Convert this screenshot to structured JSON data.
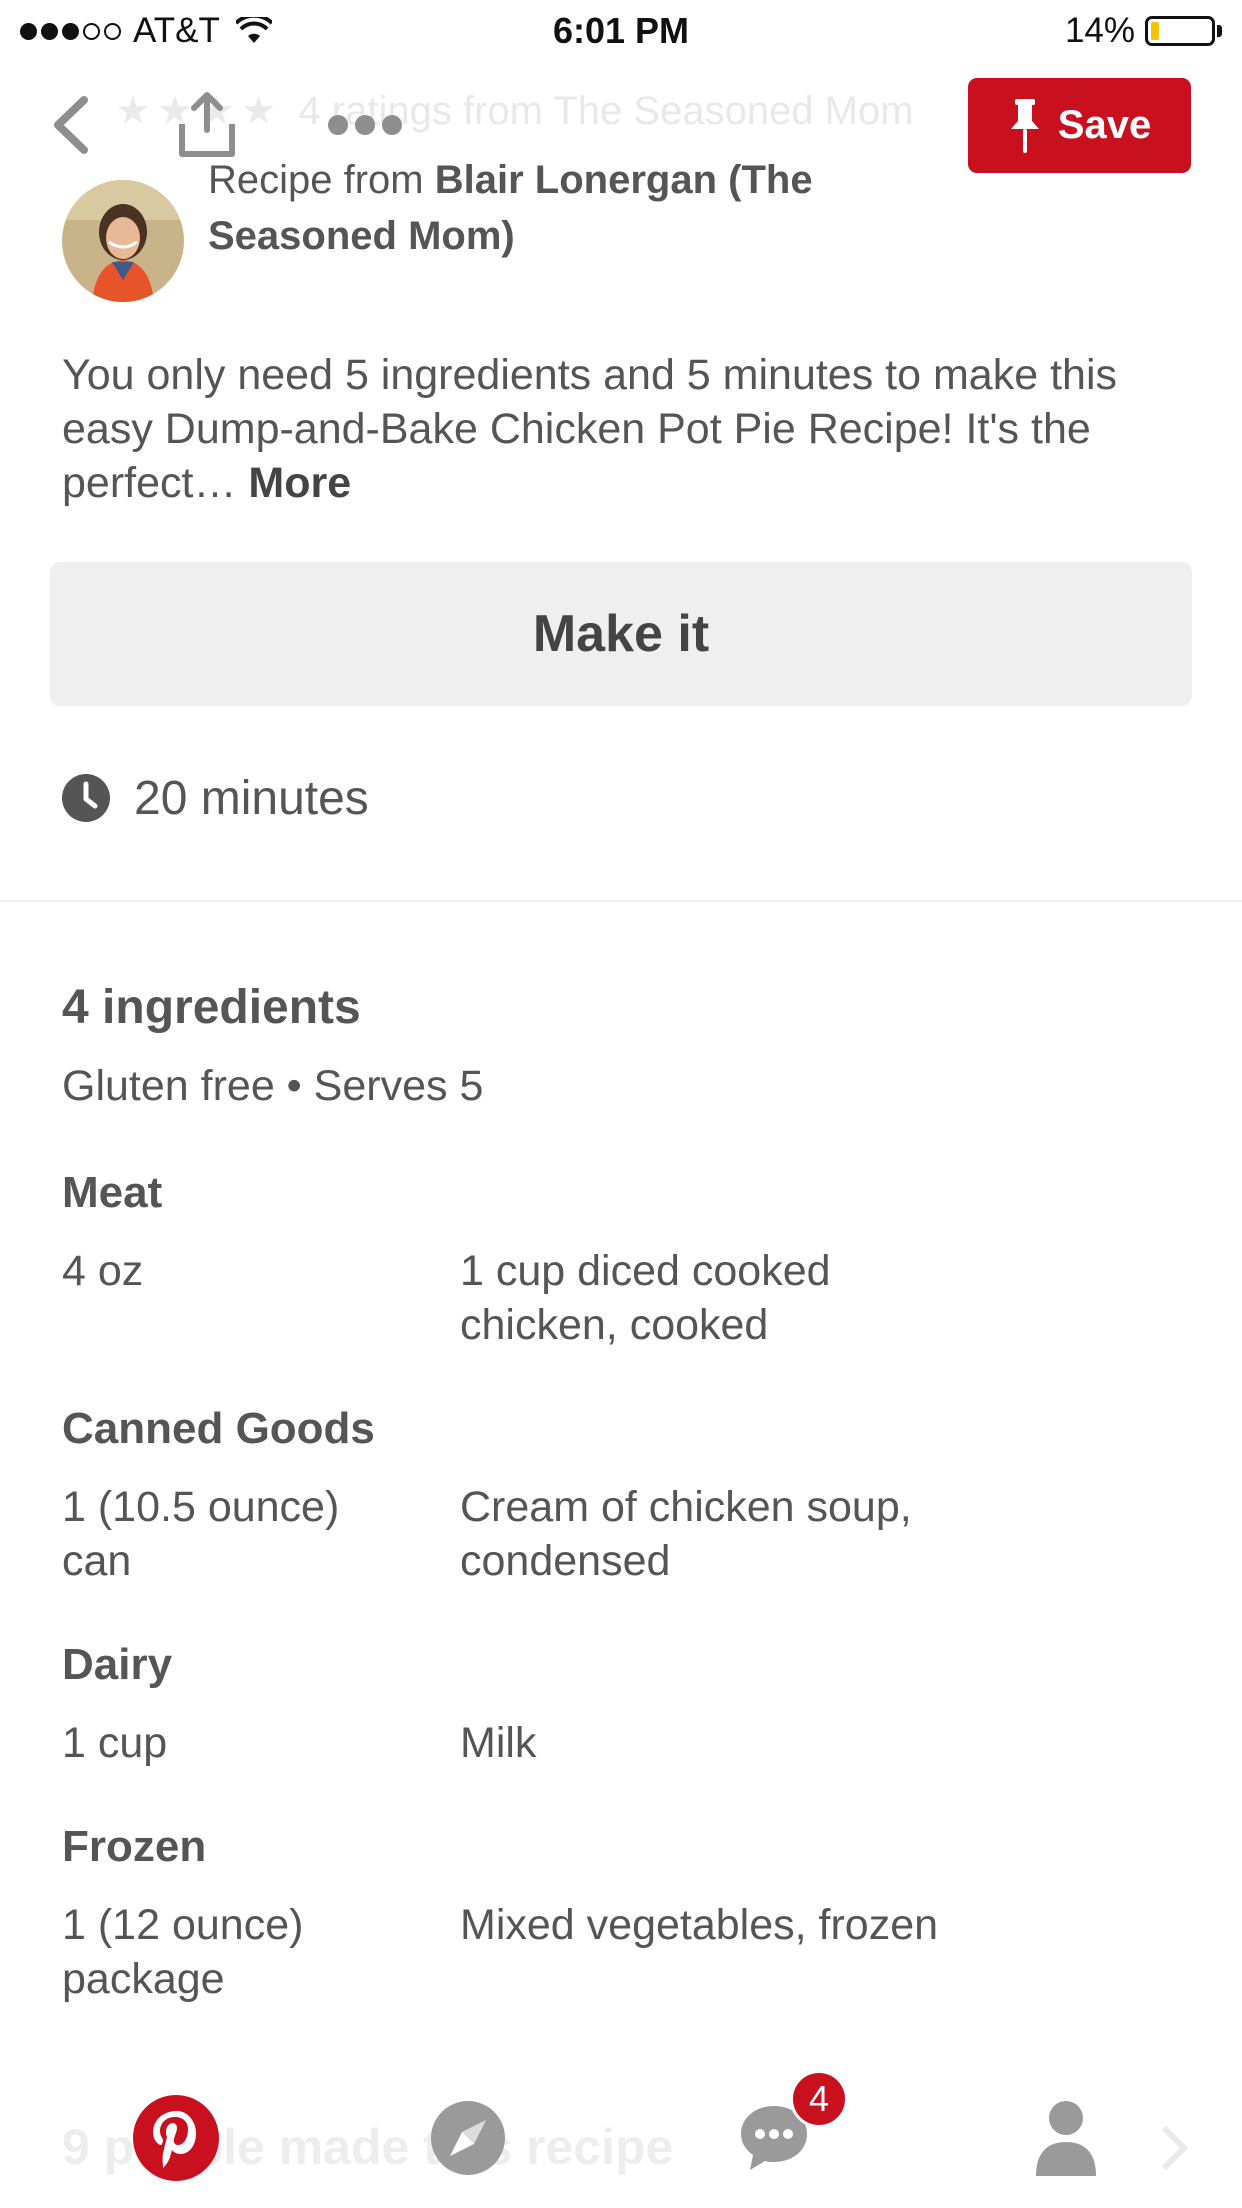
{
  "status_bar": {
    "carrier": "AT&T",
    "time": "6:01 PM",
    "battery": "14%",
    "battery_level": 0.14,
    "signal_bars": 3
  },
  "top_bar": {
    "ratings": "4 ratings from The Seasoned Mom",
    "save_label": "Save",
    "icons": [
      "back-icon",
      "share-icon",
      "more-icon",
      "pin-icon"
    ]
  },
  "recipe": {
    "source_prefix": "Recipe from",
    "source_name_line1": "Blair Lonergan (The",
    "source_name_line2": "Seasoned Mom)",
    "description": "You only need 5 ingredients and 5 minutes to make this easy Dump-and-Bake Chicken Pot Pie Recipe! It's the perfect…",
    "more_label": "More",
    "make_it_label": "Make it",
    "time": "20 minutes"
  },
  "ingredients": {
    "title": "4 ingredients",
    "meta": "Gluten free • Serves 5",
    "groups": [
      {
        "category": "Meat",
        "qty_line1": "4 oz",
        "qty_line2": "",
        "name_line1": "1 cup diced cooked",
        "name_line2": "chicken, cooked"
      },
      {
        "category": "Canned Goods",
        "qty_line1": "1 (10.5 ounce)",
        "qty_line2": "can",
        "name_line1": "Cream of chicken soup,",
        "name_line2": "condensed"
      },
      {
        "category": "Dairy",
        "qty_line1": "1 cup",
        "qty_line2": "",
        "name_line1": "Milk",
        "name_line2": ""
      },
      {
        "category": "Frozen",
        "qty_line1": "1 (12 ounce)",
        "qty_line2": "package",
        "name_line1": "Mixed vegetables, frozen",
        "name_line2": ""
      }
    ]
  },
  "footer": {
    "made_text": "9 people made this recipe"
  },
  "tab_bar": {
    "messages_badge": "4",
    "tabs": [
      "pinterest-home-icon",
      "explore-compass-icon",
      "messages-icon",
      "profile-icon"
    ]
  },
  "colors": {
    "brand_red": "#c8101e",
    "text": "#555555",
    "button_bg": "#efefef",
    "battery_fill": "#f5c400"
  }
}
